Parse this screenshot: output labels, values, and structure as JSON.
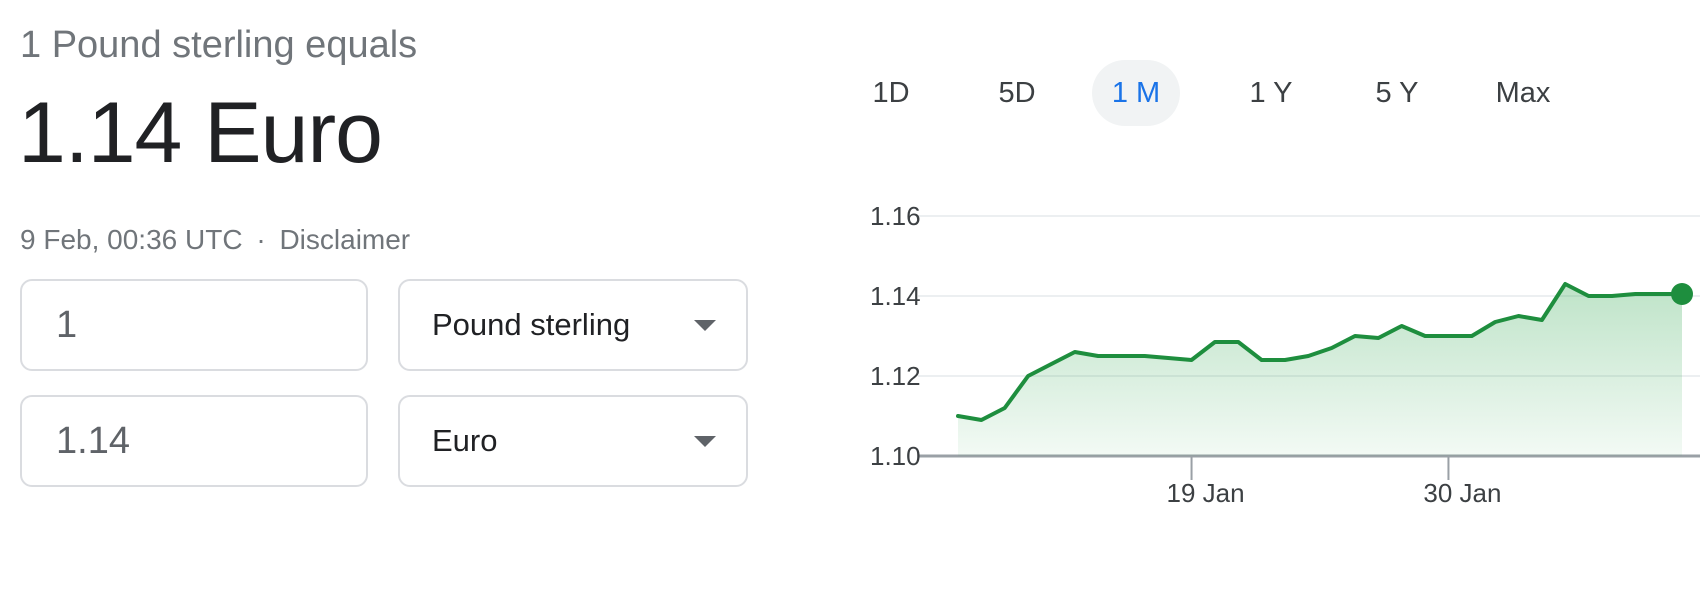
{
  "converter": {
    "subtitle": "1 Pound sterling equals",
    "result": "1.14 Euro",
    "timestamp": "9 Feb, 00:36 UTC",
    "separator": "·",
    "disclaimer": "Disclaimer",
    "from": {
      "amount": "1",
      "currency": "Pound sterling"
    },
    "to": {
      "amount": "1.14",
      "currency": "Euro"
    }
  },
  "range_tabs": [
    {
      "label": "1D",
      "active": false
    },
    {
      "label": "5D",
      "active": false
    },
    {
      "label": "1 M",
      "active": true
    },
    {
      "label": "1 Y",
      "active": false
    },
    {
      "label": "5 Y",
      "active": false
    },
    {
      "label": "Max",
      "active": false
    }
  ],
  "colors": {
    "accent": "#1a73e8",
    "line": "#1e8e3e",
    "area": "#34a853"
  },
  "chart_data": {
    "type": "area",
    "x_tick_labels": [
      "19 Jan",
      "30 Jan"
    ],
    "y_ticks": [
      1.1,
      1.12,
      1.14,
      1.16
    ],
    "y_tick_labels": [
      "1.10",
      "1.12",
      "1.14",
      "1.16"
    ],
    "ylim": [
      1.1,
      1.16
    ],
    "grid": true,
    "endpoint_marker": true,
    "series": [
      {
        "x": [
          "9 Jan",
          "10 Jan",
          "11 Jan",
          "12 Jan",
          "13 Jan",
          "14 Jan",
          "15 Jan",
          "16 Jan",
          "17 Jan",
          "18 Jan",
          "19 Jan",
          "20 Jan",
          "21 Jan",
          "22 Jan",
          "23 Jan",
          "24 Jan",
          "25 Jan",
          "26 Jan",
          "27 Jan",
          "28 Jan",
          "29 Jan",
          "30 Jan",
          "31 Jan",
          "1 Feb",
          "2 Feb",
          "3 Feb",
          "4 Feb",
          "5 Feb",
          "6 Feb",
          "7 Feb",
          "8 Feb",
          "9 Feb"
        ],
        "values": [
          1.11,
          1.109,
          1.112,
          1.12,
          1.123,
          1.126,
          1.125,
          1.125,
          1.125,
          1.1245,
          1.124,
          1.1285,
          1.1285,
          1.124,
          1.124,
          1.125,
          1.127,
          1.13,
          1.1295,
          1.1325,
          1.13,
          1.13,
          1.13,
          1.1335,
          1.135,
          1.134,
          1.143,
          1.14,
          1.14,
          1.1405,
          1.1405,
          1.1405
        ]
      }
    ]
  }
}
